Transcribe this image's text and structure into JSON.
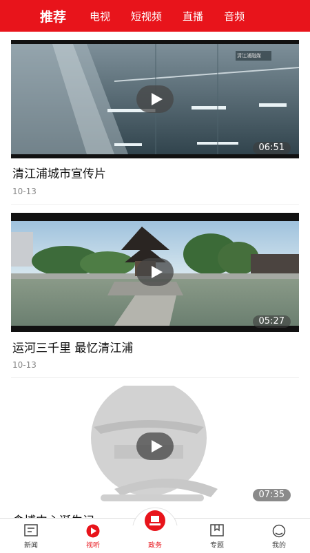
{
  "top_tabs": [
    "推荐",
    "电视",
    "短视频",
    "直播",
    "音频"
  ],
  "videos": [
    {
      "title": "清江浦城市宣传片",
      "date": "10-13",
      "duration": "06:51",
      "watermark": "清江浦融媒"
    },
    {
      "title": "运河三千里  最忆清江浦",
      "date": "10-13",
      "duration": "05:27"
    },
    {
      "title": "食博中心诞生记",
      "date": "",
      "duration": "07:35"
    }
  ],
  "bottom_nav": [
    {
      "label": "新闻",
      "icon": "news-icon"
    },
    {
      "label": "视听",
      "icon": "video-play-icon"
    },
    {
      "label": "政务",
      "icon": "government-icon"
    },
    {
      "label": "专题",
      "icon": "bookmark-icon"
    },
    {
      "label": "我的",
      "icon": "profile-icon"
    }
  ],
  "colors": {
    "accent": "#e8141b"
  }
}
